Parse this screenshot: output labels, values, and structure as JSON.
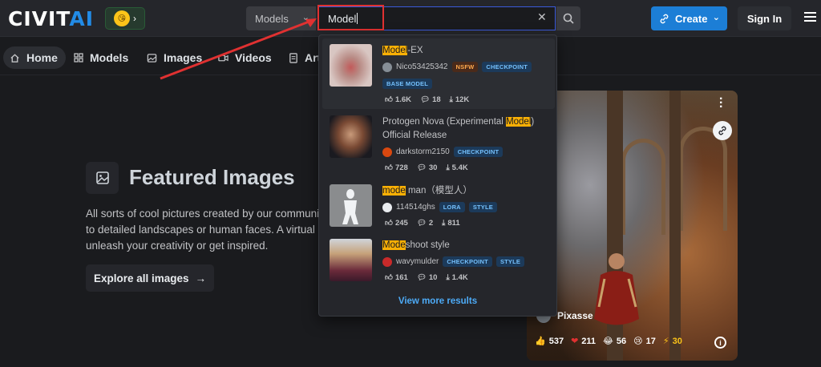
{
  "header": {
    "logo_main": "CIVIT",
    "logo_accent": "AI",
    "search_type": "Models",
    "search_value": "Model",
    "create_label": "Create",
    "signin_label": "Sign In"
  },
  "nav": {
    "items": [
      {
        "label": "Home",
        "icon": "home-icon"
      },
      {
        "label": "Models",
        "icon": "grid-icon"
      },
      {
        "label": "Images",
        "icon": "image-icon"
      },
      {
        "label": "Videos",
        "icon": "video-icon"
      },
      {
        "label": "Art",
        "icon": "article-icon"
      }
    ]
  },
  "featured": {
    "title": "Featured Images",
    "desc_lines": [
      "All sorts of cool pictures created by our community",
      "to detailed landscapes or human faces. A virtual ca",
      "unleash your creativity or get inspired."
    ],
    "explore_label": "Explore all images"
  },
  "painting": {
    "author": "Pixasse",
    "reactions": {
      "like": "537",
      "heart": "211",
      "laugh": "56",
      "cry": "17",
      "gold": "30"
    }
  },
  "dropdown": {
    "results": [
      {
        "title_mark": "Model",
        "title_rest": "-EX",
        "title_line2": "",
        "author": "Nico53425342",
        "badges": [
          "NSFW",
          "CHECKPOINT"
        ],
        "badges2": [
          "BASE MODEL"
        ],
        "likes": "1.6K",
        "comments": "18",
        "downloads": "12K"
      },
      {
        "title_pre": "Protogen Nova (Experimental ",
        "title_mark": "Model",
        "title_rest": ")",
        "title_line2": "Official Release",
        "author": "darkstorm2150",
        "badges": [
          "CHECKPOINT"
        ],
        "likes": "728",
        "comments": "30",
        "downloads": "5.4K"
      },
      {
        "title_mark": "mode",
        "title_rest": " man（模型人）",
        "author": "114514ghs",
        "badges": [
          "LORA",
          "STYLE"
        ],
        "likes": "245",
        "comments": "2",
        "downloads": "811"
      },
      {
        "title_mark": "Mode",
        "title_rest": "shoot style",
        "author": "wavymulder",
        "badges": [
          "CHECKPOINT",
          "STYLE"
        ],
        "likes": "161",
        "comments": "10",
        "downloads": "1.4K"
      }
    ],
    "view_more": "View more results"
  },
  "colors": {
    "accent": "#1c7ed6",
    "highlight": "#fab005",
    "annotation_red": "#e03131"
  }
}
